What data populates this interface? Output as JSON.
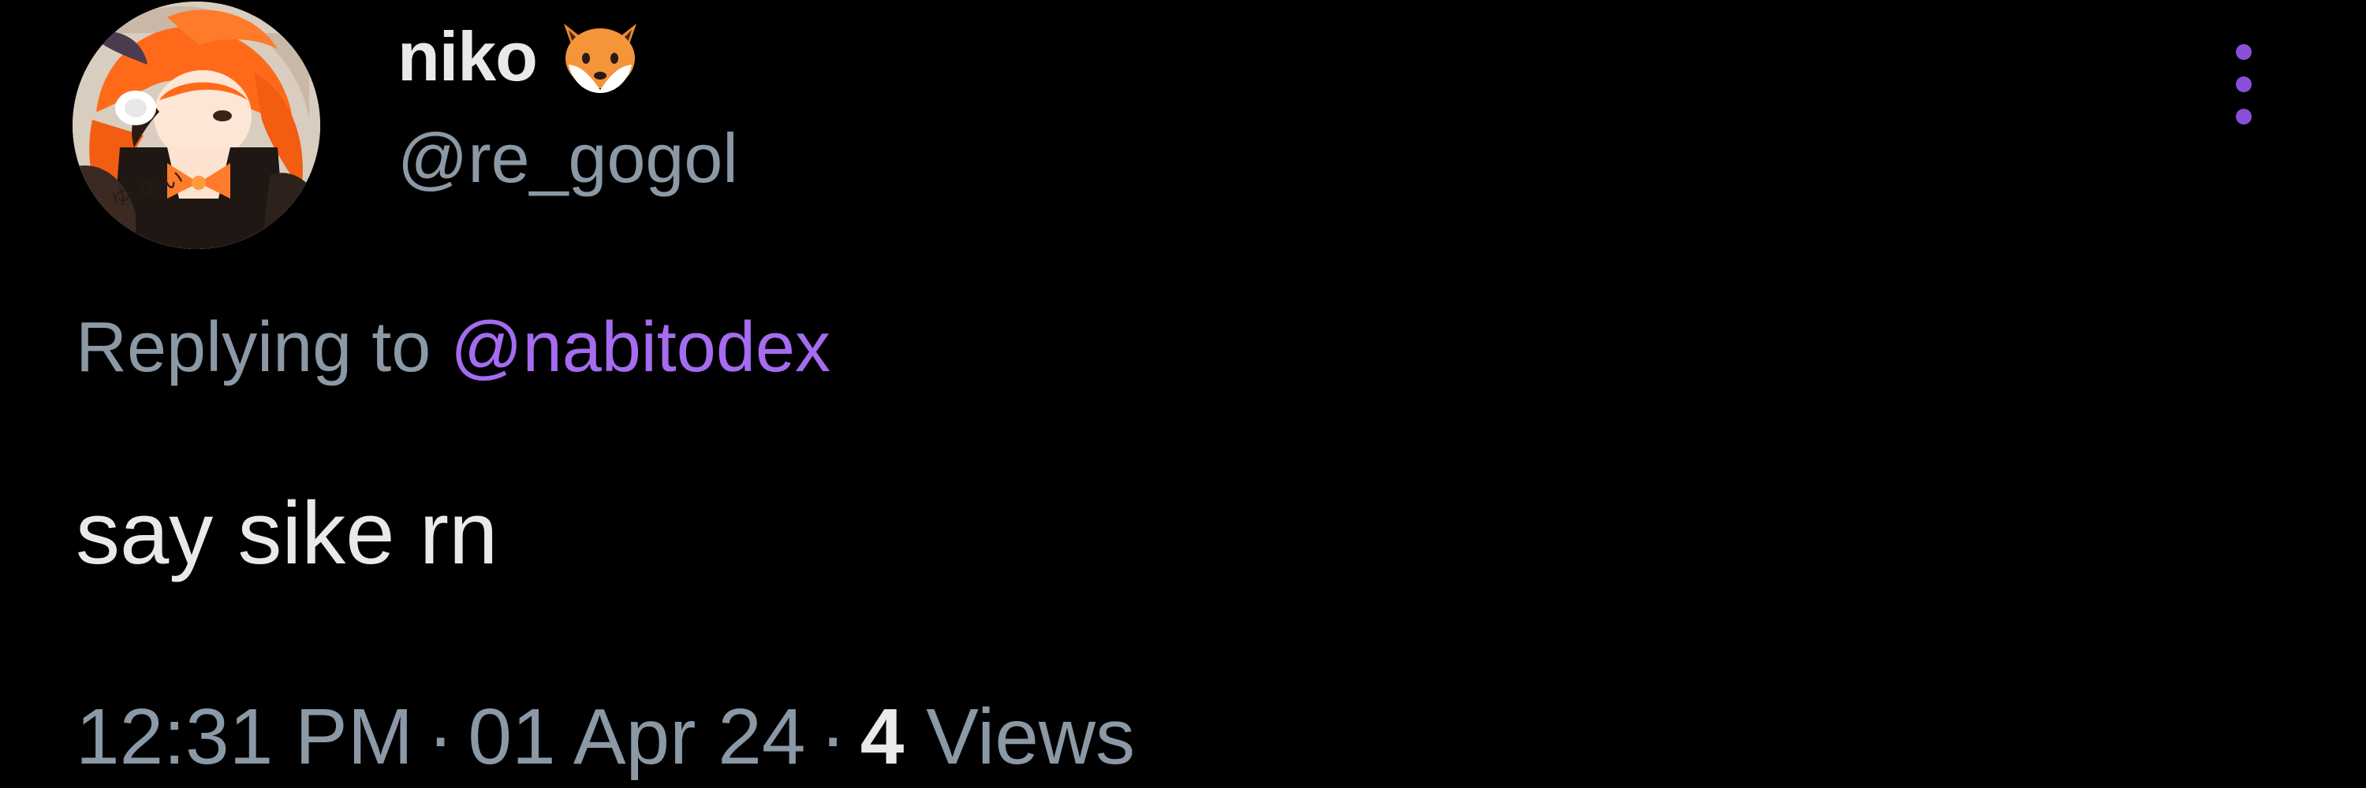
{
  "tweet": {
    "author": {
      "display_name": "niko",
      "emoji": "fox-face",
      "handle": "@re_gogol",
      "avatar": "anime-girl-orange-hair-avatar"
    },
    "more_icon": "three-dots-vertical-icon",
    "reply_context": {
      "prefix": "Replying to",
      "handle": "@nabitodex"
    },
    "text": "say sike rn",
    "meta": {
      "time": "12:31 PM",
      "separator": "·",
      "date": "01 Apr 24",
      "views_count": "4",
      "views_label": "Views"
    }
  },
  "colors": {
    "background": "#000000",
    "primary_text": "#e7e9ea",
    "secondary_text": "#8b98a5",
    "accent": "#a56bf0"
  }
}
